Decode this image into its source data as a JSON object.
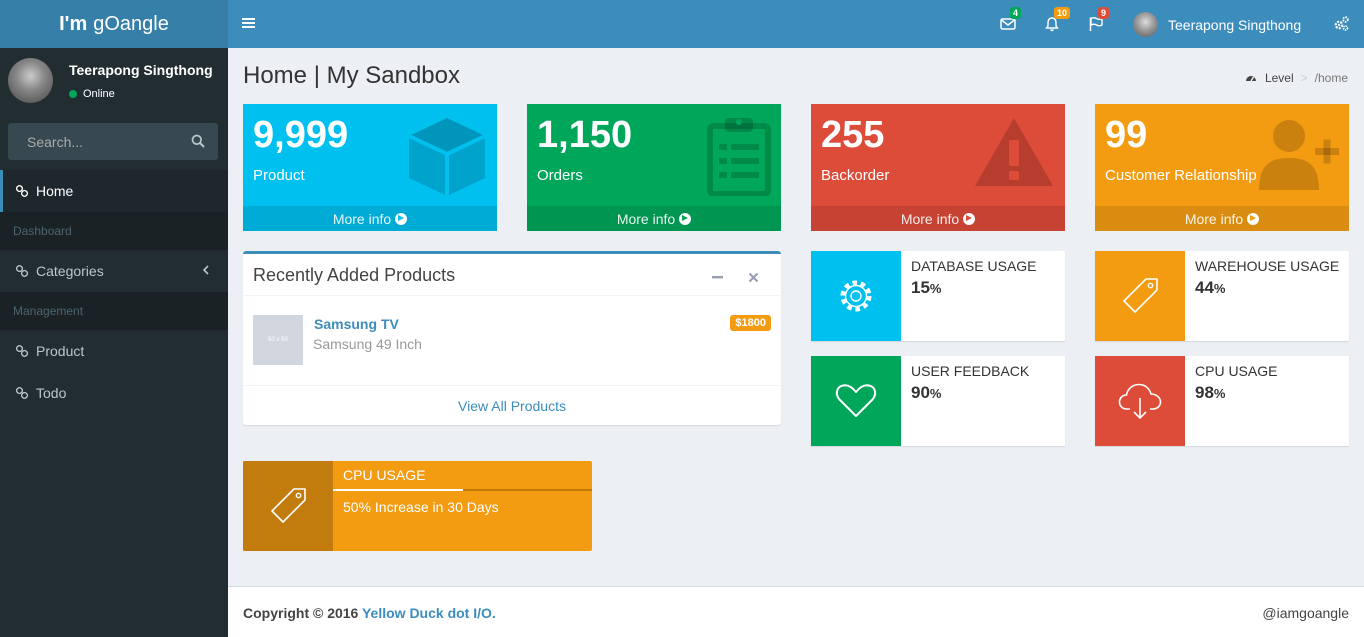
{
  "app": {
    "logo_bold": "I'm",
    "logo_rest": "gOangle"
  },
  "topbar": {
    "messages_badge": "4",
    "notifications_badge": "10",
    "flags_badge": "9",
    "user_name": "Teerapong Singthong"
  },
  "sidebar": {
    "user_name": "Teerapong Singthong",
    "status": "Online",
    "search_placeholder": "Search...",
    "home": "Home",
    "header_dashboard": "Dashboard",
    "categories": "Categories",
    "header_management": "Management",
    "product": "Product",
    "todo": "Todo"
  },
  "page": {
    "title": "Home | My Sandbox",
    "breadcrumb_level": "Level",
    "breadcrumb_sep": ">",
    "breadcrumb_current": "/home"
  },
  "stats": [
    {
      "number": "9,999",
      "label": "Product",
      "more": "More info",
      "color": "#00c0ef",
      "icon": "cube-icon"
    },
    {
      "number": "1,150",
      "label": "Orders",
      "more": "More info",
      "color": "#00a65a",
      "icon": "clipboard-icon"
    },
    {
      "number": "255",
      "label": "Backorder",
      "more": "More info",
      "color": "#dd4b39",
      "icon": "warning-icon"
    },
    {
      "number": "99",
      "label": "Customer Relationship",
      "more": "More info",
      "color": "#f39c12",
      "icon": "user-plus-icon"
    }
  ],
  "recent": {
    "title": "Recently Added Products",
    "product_image_text": "50 x 50",
    "product_name": "Samsung TV",
    "product_desc": "Samsung 49 Inch",
    "product_price": "$1800",
    "view_all": "View All Products"
  },
  "usage": [
    {
      "label": "DATABASE USAGE",
      "value": "15",
      "unit": "%",
      "color": "#00c0ef",
      "icon": "gear-icon"
    },
    {
      "label": "WAREHOUSE USAGE",
      "value": "44",
      "unit": "%",
      "color": "#f39c12",
      "icon": "tag-icon"
    },
    {
      "label": "USER FEEDBACK",
      "value": "90",
      "unit": "%",
      "color": "#00a65a",
      "icon": "heart-icon"
    },
    {
      "label": "CPU USAGE",
      "value": "98",
      "unit": "%",
      "color": "#dd4b39",
      "icon": "cloud-download-icon"
    }
  ],
  "cpu_progress": {
    "label": "CPU USAGE",
    "description": "50% Increase in 30 Days",
    "percent": 50
  },
  "footer": {
    "copyright": "Copyright © 2016",
    "company": "Yellow Duck dot I/O.",
    "handle": "@iamgoangle"
  }
}
